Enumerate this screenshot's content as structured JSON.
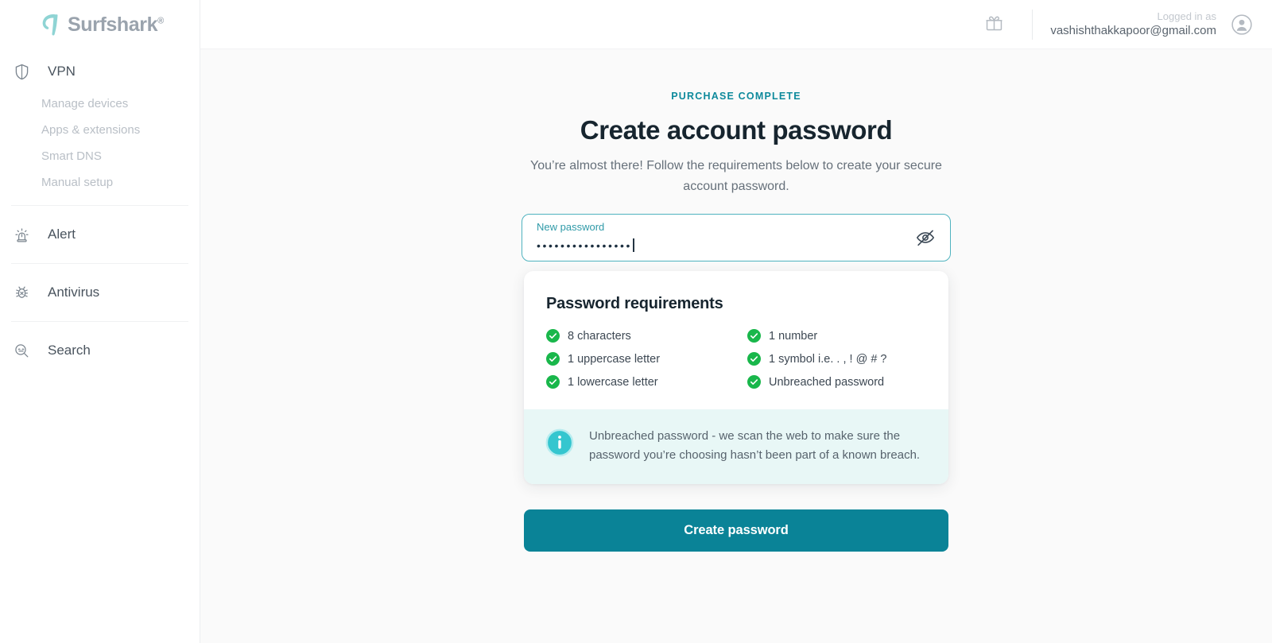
{
  "brand": {
    "name": "Surfshark",
    "registered_mark": "®",
    "logo_color": "#8fd4d4",
    "wordmark_color": "#9aa3ad"
  },
  "sidebar": {
    "items": [
      {
        "label": "VPN",
        "icon": "shield-icon",
        "type": "main"
      },
      {
        "label": "Manage devices",
        "icon": "",
        "type": "sub"
      },
      {
        "label": "Apps & extensions",
        "icon": "",
        "type": "sub"
      },
      {
        "label": "Smart DNS",
        "icon": "",
        "type": "sub"
      },
      {
        "label": "Manual setup",
        "icon": "",
        "type": "sub"
      },
      {
        "label": "Alert",
        "icon": "siren-icon",
        "type": "main"
      },
      {
        "label": "Antivirus",
        "icon": "bug-icon",
        "type": "main"
      },
      {
        "label": "Search",
        "icon": "magnifier-icon",
        "type": "main"
      }
    ]
  },
  "topbar": {
    "gift_icon": "gift-icon",
    "logged_in_label": "Logged in as",
    "email": "vashishthakkapoor@gmail.com",
    "avatar_icon": "user-avatar-icon"
  },
  "main": {
    "eyebrow": "PURCHASE COMPLETE",
    "eyebrow_color": "#0e8a9c",
    "title": "Create account password",
    "subtitle": "You’re almost there! Follow the requirements below to create your secure account password.",
    "password_field": {
      "label": "New password",
      "value": "••••••••••••••••",
      "placeholder": "New password",
      "toggle_icon": "eye-off-icon",
      "border_color": "#4fb3bf"
    },
    "requirements": {
      "heading": "Password requirements",
      "check_color": "#19b74b",
      "left_column": [
        {
          "label": "8 characters",
          "met": true
        },
        {
          "label": "1 uppercase letter",
          "met": true
        },
        {
          "label": "1 lowercase letter",
          "met": true
        }
      ],
      "right_column": [
        {
          "label": "1 number",
          "met": true
        },
        {
          "label": "1 symbol i.e. . , ! @ # ?",
          "met": true
        },
        {
          "label": "Unbreached password",
          "met": true
        }
      ]
    },
    "info_notice": {
      "icon": "info-icon",
      "icon_color": "#35c6cf",
      "background": "#e8f7f6",
      "text": "Unbreached password - we scan the web to make sure the password you’re choosing hasn’t been part of a known breach."
    },
    "cta": {
      "label": "Create password",
      "background": "#0a8397",
      "text_color": "#ffffff"
    }
  }
}
